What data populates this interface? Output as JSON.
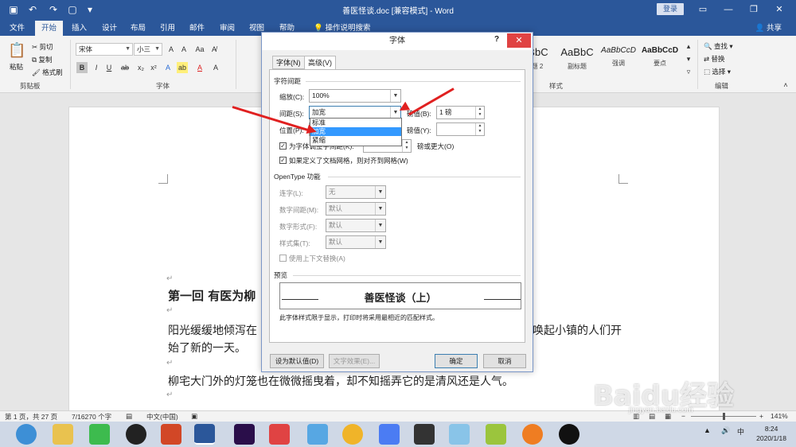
{
  "window": {
    "title": "善医怪谈.doc [兼容模式] - Word",
    "login_label": "登录",
    "share_label": "共享"
  },
  "menu_tabs": [
    "文件",
    "开始",
    "插入",
    "设计",
    "布局",
    "引用",
    "邮件",
    "审阅",
    "视图",
    "帮助",
    "操作说明搜索"
  ],
  "ribbon": {
    "clipboard": {
      "paste": "粘贴",
      "cut": "剪切",
      "copy": "复制",
      "format_painter": "格式刷",
      "group": "剪贴板"
    },
    "font": {
      "name": "宋体",
      "size": "小三",
      "group": "字体"
    },
    "styles": {
      "items": [
        {
          "sample": "AaBbC",
          "name": "标题 2"
        },
        {
          "sample": "AaBbC",
          "name": "副标题"
        },
        {
          "sample": "AaBbCcD",
          "name": "强调"
        },
        {
          "sample": "AaBbCcD",
          "name": "要点"
        }
      ],
      "group": "样式"
    },
    "editing": {
      "find": "查找",
      "replace": "替换",
      "select": "选择",
      "group": "编辑"
    }
  },
  "document": {
    "paragraphs": [
      "第一回 有医为柳",
      "阳光缓缓地倾泻在",
      "唤起小镇的人们开",
      "始了新的一天。",
      "柳宅大门外的灯笼也在微微摇曳着，却不知摇弄它的是清风还是人气。"
    ]
  },
  "dialog": {
    "title": "字体",
    "help": "?",
    "tabs": [
      "字体(N)",
      "高级(V)"
    ],
    "char_spacing_section": "字符间距",
    "scale_label": "缩放(C):",
    "scale_value": "100%",
    "spacing_label": "间距(S):",
    "spacing_value": "加宽",
    "spacing_by_label": "磅值(B):",
    "spacing_by_value": "1 磅",
    "position_label": "位置(P):",
    "position_by_label": "磅值(Y):",
    "kerning_label": "为字体调整字间距(K):",
    "kerning_suffix": "磅或更大(O)",
    "grid_label": "如果定义了文档网格，则对齐到网格(W)",
    "spacing_options": [
      "标准",
      "加宽",
      "紧缩"
    ],
    "spacing_highlighted": "加宽",
    "opentype_section": "OpenType 功能",
    "ligatures_label": "连字(L):",
    "ligatures_value": "无",
    "number_spacing_label": "数字间距(M):",
    "number_spacing_value": "默认",
    "number_forms_label": "数字形式(F):",
    "number_forms_value": "默认",
    "stylistic_sets_label": "样式集(T):",
    "stylistic_sets_value": "默认",
    "contextual_label": "使用上下文替换(A)",
    "preview_section": "预览",
    "preview_text": "善医怪谈（上）",
    "preview_note": "此字体样式限于显示，打印时将采用最相近的匹配样式。",
    "set_default_btn": "设为默认值(D)",
    "text_effects_btn": "文字效果(E)...",
    "ok_btn": "确定",
    "cancel_btn": "取消"
  },
  "statusbar": {
    "page": "第 1 页，共 27 页",
    "words": "7/16270 个字",
    "language": "中文(中国)",
    "zoom": "141%"
  },
  "taskbar": {
    "time": "8:24",
    "date": "2020/1/18"
  },
  "watermark": {
    "text": "Baidu经验",
    "sub": "jingyan.baidu.com"
  },
  "colors": {
    "title_bar": "#2b579a",
    "arrow": "#e02020",
    "highlight": "#3399ff",
    "close": "#e04343"
  }
}
